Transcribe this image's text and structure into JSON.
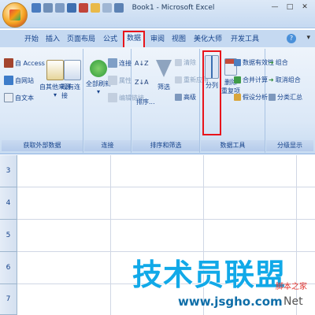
{
  "window": {
    "title": "Book1 - Microsoft Excel"
  },
  "tabs": [
    {
      "label": "开始"
    },
    {
      "label": "插入"
    },
    {
      "label": "页面布局"
    },
    {
      "label": "公式"
    },
    {
      "label": "数据"
    },
    {
      "label": "审阅"
    },
    {
      "label": "视图"
    },
    {
      "label": "美化大师"
    },
    {
      "label": "开发工具"
    }
  ],
  "ribbon": {
    "external": {
      "label": "获取外部数据",
      "access": "自 Access",
      "web": "自网站",
      "text": "自文本",
      "other": "自其他来源",
      "existing": "现有连接"
    },
    "connections": {
      "label": "连接",
      "refresh_all": "全部刷新",
      "connections": "连接",
      "properties": "属性",
      "edit_links": "编辑链接"
    },
    "sort_filter": {
      "label": "排序和筛选",
      "sort": "排序...",
      "filter": "筛选",
      "clear": "清除",
      "reapply": "重新应用",
      "advanced": "高级"
    },
    "data_tools": {
      "label": "数据工具",
      "split": "分列",
      "remove_dup": "删除",
      "remove_dup2": "重复项",
      "validation": "数据有效性",
      "consolidate": "合并计算",
      "whatif": "假设分析"
    },
    "outline": {
      "label": "分级显示",
      "group": "组合",
      "ungroup": "取消组合",
      "subtotal": "分类汇总"
    }
  },
  "sheet": {
    "rows": [
      "3",
      "4",
      "5",
      "6",
      "7"
    ]
  },
  "watermark": {
    "text": "技术员联盟",
    "url": "www.jsgho.com",
    "sub": "脚本之家",
    "net": "Net"
  }
}
